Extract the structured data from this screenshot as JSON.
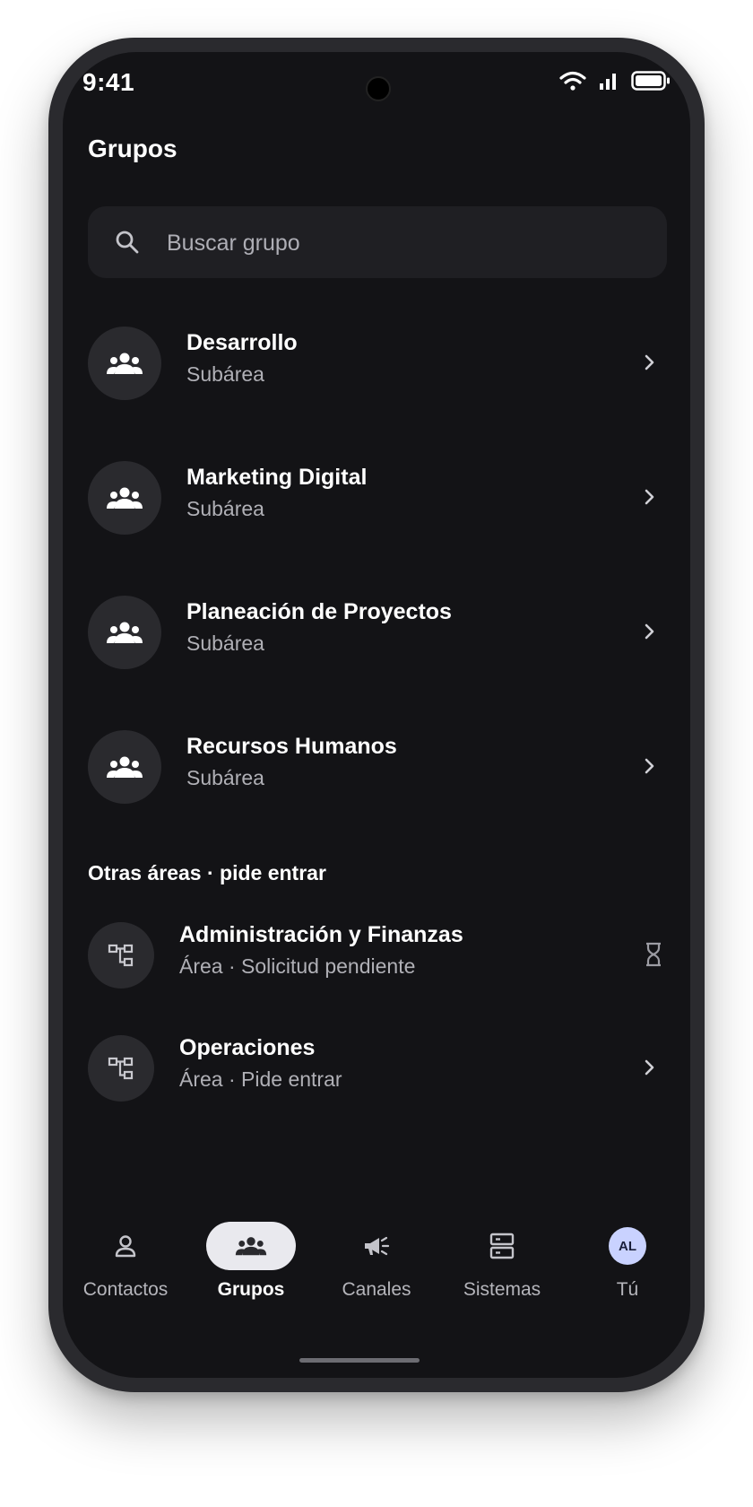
{
  "status_bar": {
    "time": "9:41"
  },
  "header": {
    "title": "Grupos"
  },
  "search": {
    "placeholder": "Buscar grupo",
    "value": ""
  },
  "groups": [
    {
      "name": "Desarrollo",
      "subtitle": "Subárea"
    },
    {
      "name": "Marketing Digital",
      "subtitle": "Subárea"
    },
    {
      "name": "Planeación de Proyectos",
      "subtitle": "Subárea"
    },
    {
      "name": "Recursos Humanos",
      "subtitle": "Subárea"
    }
  ],
  "other_areas": {
    "label": "Otras áreas · pide entrar",
    "items": [
      {
        "name": "Administración y Finanzas",
        "subtitle": "Área · Solicitud pendiente",
        "trailing_icon": "hourglass-icon"
      },
      {
        "name": "Operaciones",
        "subtitle": "Área · Pide entrar",
        "trailing_icon": "chevron-right-icon"
      }
    ]
  },
  "bottom_nav": {
    "items": [
      {
        "label": "Contactos",
        "icon": "person-icon"
      },
      {
        "label": "Grupos",
        "icon": "group-icon",
        "active": true
      },
      {
        "label": "Canales",
        "icon": "megaphone-icon"
      },
      {
        "label": "Sistemas",
        "icon": "server-icon"
      },
      {
        "label": "Tú",
        "icon": "avatar"
      }
    ],
    "me_initials": "AL"
  },
  "colors": {
    "background": "#131316",
    "surface": "#1f1f23",
    "avatar_bg": "#2a2a2e",
    "secondary_text": "#b0b0b6",
    "active_pill": "#e9e9ee",
    "me_avatar": "#c9d2ff"
  }
}
